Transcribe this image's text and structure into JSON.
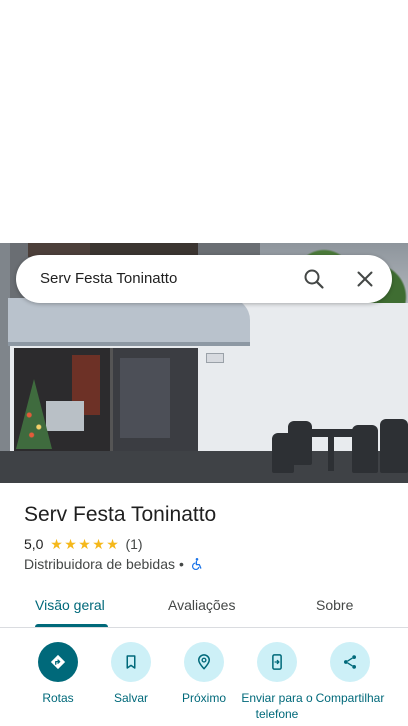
{
  "search": {
    "query": "Serv Festa Toninatto"
  },
  "place": {
    "title": "Serv Festa Toninatto",
    "rating": "5,0",
    "stars": [
      "★",
      "★",
      "★",
      "★",
      "★"
    ],
    "review_count": "(1)",
    "category": "Distribuidora de bebidas",
    "separator": "•"
  },
  "tabs": [
    {
      "label": "Visão geral",
      "active": true
    },
    {
      "label": "Avaliações",
      "active": false
    },
    {
      "label": "Sobre",
      "active": false
    }
  ],
  "actions": [
    {
      "label": "Rotas",
      "icon": "directions-icon"
    },
    {
      "label": "Salvar",
      "icon": "bookmark-icon"
    },
    {
      "label": "Próximo",
      "icon": "nearby-icon"
    },
    {
      "label": "Enviar para o telefone",
      "icon": "send-to-phone-icon"
    },
    {
      "label": "Compartilhar",
      "icon": "share-icon"
    }
  ],
  "colors": {
    "accent": "#00697a",
    "action_bg": "#cdf0f7",
    "star": "#f5b81b",
    "accessibility": "#1a73e8"
  }
}
